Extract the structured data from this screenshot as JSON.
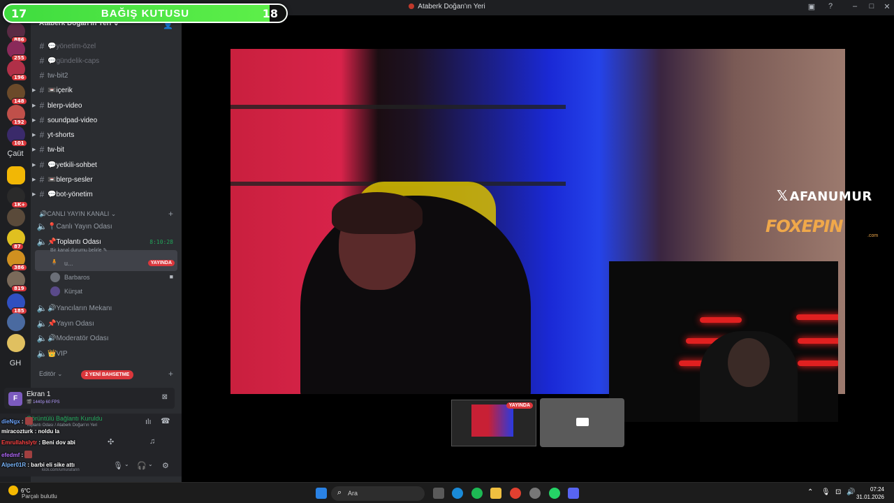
{
  "window": {
    "title": "Ataberk Doğan'ın Yeri"
  },
  "donation": {
    "left_num": "17",
    "label": "BAĞIŞ KUTUSU",
    "right_num": "18",
    "progress": 0.94
  },
  "rail": {
    "badges": [
      "886",
      "255",
      "196",
      "148",
      "192",
      "101",
      "1K+",
      "87",
      "386",
      "819",
      "185"
    ],
    "caut": "Çaüt",
    "gh": "GH"
  },
  "sidebar": {
    "server_name": "Ataberk Doğan'ın Yeri",
    "channels": [
      {
        "label": "💬yönetim-özel"
      },
      {
        "label": "💬gündelik-caps"
      },
      {
        "label": "tw-bit2"
      },
      {
        "label": "📼içerik"
      },
      {
        "label": "blerp-video"
      },
      {
        "label": "soundpad-video"
      },
      {
        "label": "yt-shorts"
      },
      {
        "label": "tw-bit"
      },
      {
        "label": "💬yetkili-sohbet"
      },
      {
        "label": "📼blerp-sesler"
      },
      {
        "label": "💬bot-yönetim"
      }
    ],
    "voice_category": "🔊CANLI YAYIN KANALI",
    "voice_channels": [
      {
        "label": "📍Canlı Yayın Odası"
      },
      {
        "label": "📌Toplantı Odası",
        "status": "Bir kanal durumu belirle",
        "timer": "8:10:28"
      }
    ],
    "voice_users": [
      {
        "name": "u...",
        "live": "YAYINDA"
      },
      {
        "name": "Barbaros"
      },
      {
        "name": "Kürşat"
      }
    ],
    "voice_channels_2": [
      {
        "label": "🔊Yancıların Mekanı"
      },
      {
        "label": "📌Yayın Odası"
      },
      {
        "label": "🔊Moderatör Odası"
      },
      {
        "label": "👑VIP"
      }
    ],
    "editor_category": "Editör",
    "new_badge": "2 YENİ BAHSETME"
  },
  "ekran": {
    "title": "Ekran 1",
    "sub": "🎬 1440p 60 FPS",
    "letter": "F"
  },
  "connection": {
    "status": "Görüntülü Bağlantı Kuruldu",
    "sub": "Toplantı Odası / Ataberk Doğan'ın Yeri"
  },
  "chat": [
    {
      "user": "dieNgx",
      "color": "#6ea6ff",
      "text": "",
      "emote": true
    },
    {
      "user": "miracozturk",
      "color": "#ffffff",
      "text": "noldu la",
      "emote": false
    },
    {
      "user": "Emrullahslytr",
      "color": "#ff4545",
      "text": "Beni dov abi",
      "emote": false
    },
    {
      "user": "efedmf",
      "color": "#b56bff",
      "text": "",
      "emote": true
    },
    {
      "user": "Alper01R",
      "color": "#7bb8ff",
      "text": "barbi eli sike attı",
      "emote": false
    }
  ],
  "kick_link": "kick.com/umurafann",
  "overlays": {
    "x_handle": "AFANUMUR",
    "x_glyph": "𝕏",
    "fox_brand": "FOXEPIN",
    "fox_com": ".com"
  },
  "tiles": {
    "live_label": "YAYINDA"
  },
  "taskbar": {
    "weather_temp": "6°C",
    "weather_desc": "Parçalı bulutlu",
    "search_placeholder": "Ara",
    "time": "07:24",
    "date": "31.01.2026"
  }
}
